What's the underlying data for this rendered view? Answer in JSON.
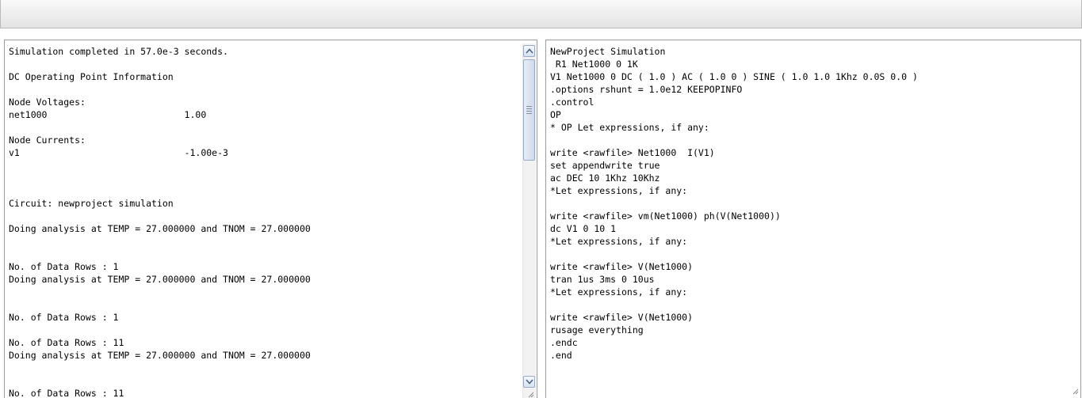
{
  "output_panel": {
    "lines": [
      "Simulation completed in 57.0e-3 seconds.",
      "",
      "DC Operating Point Information",
      "",
      "Node Voltages:",
      "net1000                         1.00",
      "",
      "Node Currents:",
      "v1                              -1.00e-3",
      "",
      "",
      "",
      "Circuit: newproject simulation",
      "",
      "Doing analysis at TEMP = 27.000000 and TNOM = 27.000000",
      "",
      "",
      "No. of Data Rows : 1",
      "Doing analysis at TEMP = 27.000000 and TNOM = 27.000000",
      "",
      "",
      "No. of Data Rows : 1",
      "",
      "No. of Data Rows : 11",
      "Doing analysis at TEMP = 27.000000 and TNOM = 27.000000",
      "",
      "",
      "No. of Data Rows : 11"
    ]
  },
  "netlist_panel": {
    "lines": [
      "NewProject Simulation",
      " R1 Net1000 0 1K",
      "V1 Net1000 0 DC ( 1.0 ) AC ( 1.0 0 ) SINE ( 1.0 1.0 1Khz 0.0S 0.0 )",
      ".options rshunt = 1.0e12 KEEPOPINFO",
      ".control",
      "OP",
      "* OP Let expressions, if any:",
      "",
      "write <rawfile> Net1000  I(V1)",
      "set appendwrite true",
      "ac DEC 10 1Khz 10Khz",
      "*Let expressions, if any:",
      "",
      "write <rawfile> vm(Net1000) ph(V(Net1000))",
      "dc V1 0 10 1",
      "*Let expressions, if any:",
      "",
      "write <rawfile> V(Net1000)",
      "tran 1us 3ms 0 10us",
      "*Let expressions, if any:",
      "",
      "write <rawfile> V(Net1000)",
      "rusage everything",
      ".endc",
      ".end"
    ]
  },
  "icons": {
    "scroll_up": "arrow-up-icon",
    "scroll_down": "arrow-down-icon",
    "resize": "resize-grip-icon"
  },
  "colors": {
    "toolbar_border": "#b9b9b9",
    "panel_border": "#9c9c9c",
    "scrollbar_accent": "#9aaac2"
  }
}
